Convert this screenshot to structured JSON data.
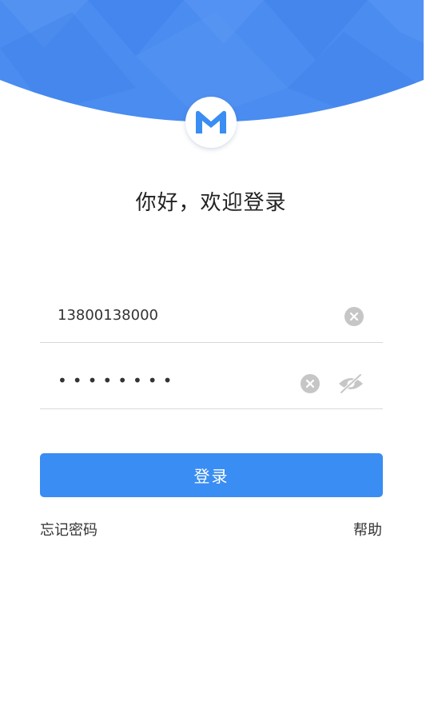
{
  "colors": {
    "header_blue": "#4a8cf0",
    "header_blue_light": "#5b98f3",
    "header_blue_dark": "#3f7ee8",
    "button_blue": "#3a8df2",
    "logo_blue": "#3a8df2",
    "clear_icon_gray": "#c6c6c6",
    "underline_gray": "#d9d9d9"
  },
  "logo": {
    "icon": "m-logo-icon"
  },
  "title": "你好，欢迎登录",
  "phone_field": {
    "value": "13800138000",
    "clear_icon": "clear-circle-icon"
  },
  "password_field": {
    "masked_value": "••••••••",
    "clear_icon": "clear-circle-icon",
    "visibility_icon": "eye-off-icon"
  },
  "login_button": {
    "label": "登录"
  },
  "links": {
    "forgot_password": "忘记密码",
    "help": "帮助"
  }
}
